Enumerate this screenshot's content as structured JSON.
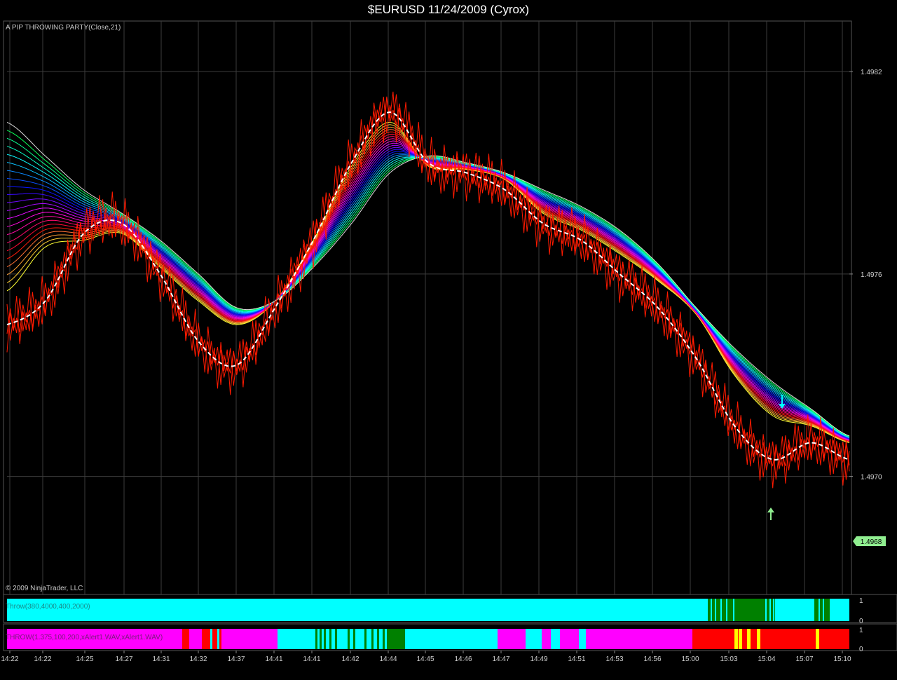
{
  "title": "$EURUSD  11/24/2009 (Cyrox)",
  "indicator_label": "A PIP THROWING PARTY(Close,21)",
  "copyright": "© 2009 NinjaTrader, LLC",
  "last_price_label": "1.4968",
  "colors": {
    "background": "#000000",
    "grid": "#3a3a3a",
    "price": "#ff1a00",
    "dashed_ma": "#ffffff",
    "panel_cyan": "#00ffff",
    "panel_green": "#008000",
    "panel_magenta": "#ff00ff",
    "panel_red": "#ff0000",
    "panel_yellow": "#ffff00",
    "price_tag": "#90ee90"
  },
  "chart_data": {
    "type": "line",
    "title": "$EURUSD  11/24/2009 (Cyrox)",
    "ylim": [
      1.49665,
      1.49835
    ],
    "yticks": [
      "1.4982",
      "1.4976",
      "1.4970"
    ],
    "ytick_values": [
      1.4982,
      1.4976,
      1.497
    ],
    "last_price": 1.4968,
    "xtick_labels": [
      "14:22",
      "14:22",
      "14:25",
      "14:27",
      "14:31",
      "14:32",
      "14:37",
      "14:41",
      "14:41",
      "14:42",
      "14:44",
      "14:45",
      "14:46",
      "14:47",
      "14:49",
      "14:51",
      "14:53",
      "14:56",
      "15:00",
      "15:03",
      "15:04",
      "15:07",
      "15:10"
    ],
    "x": [
      0,
      1,
      2,
      3,
      4,
      5,
      6,
      7,
      8,
      9,
      10,
      11,
      12,
      13,
      14,
      15,
      16,
      17,
      18,
      19,
      20,
      21,
      22
    ],
    "series": [
      {
        "values": [
          1.49745,
          1.49752,
          1.49772,
          1.49775,
          1.4976,
          1.4974,
          1.49733,
          1.4975,
          1.4977,
          1.49793,
          1.49808,
          1.49793,
          1.4979,
          1.49785,
          1.49775,
          1.4977,
          1.4976,
          1.4975,
          1.49735,
          1.49715,
          1.49705,
          1.4971,
          1.49705
        ]
      },
      {
        "name": "",
        "values": [
          1.49755,
          1.49768,
          1.4977,
          1.49772,
          1.49762,
          1.49752,
          1.49745,
          1.49752,
          1.4977,
          1.49792,
          1.49805,
          1.49792,
          1.49791,
          1.49788,
          1.49778,
          1.49773,
          1.49766,
          1.49758,
          1.49748,
          1.4973,
          1.49718,
          1.49715,
          1.4971
        ]
      },
      {
        "name": "",
        "values": [
          1.49805,
          1.49795,
          1.49785,
          1.49778,
          1.4977,
          1.4976,
          1.4975,
          1.49752,
          1.49762,
          1.49775,
          1.4979,
          1.49795,
          1.49793,
          1.4979,
          1.49785,
          1.4978,
          1.49773,
          1.49763,
          1.4975,
          1.49738,
          1.49728,
          1.4972,
          1.49712
        ]
      }
    ],
    "lower_panels": [
      {
        "label": "Throw(380,4000,400,2000)",
        "scale": [
          "1",
          "0"
        ]
      },
      {
        "label": "THROW(1.375,100,200,xAlert1.WAV,xAlert1.WAV)",
        "scale": [
          "1",
          "0"
        ]
      }
    ]
  }
}
